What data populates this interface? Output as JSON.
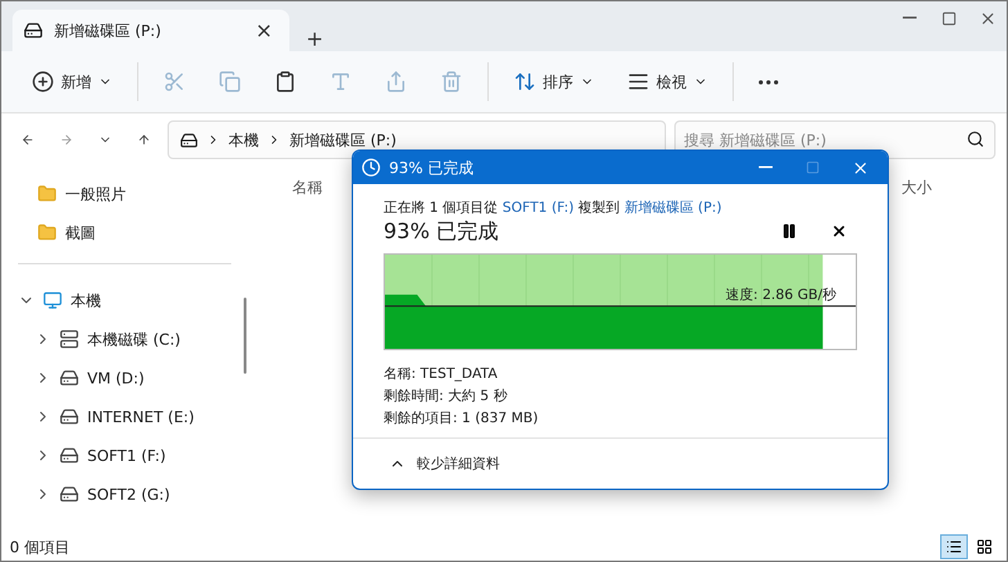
{
  "tab": {
    "title": "新增磁碟區 (P:)",
    "close": "×",
    "new_tab": "+"
  },
  "toolbar": [
    {
      "kind": "new",
      "label": "新增",
      "disabled": false,
      "menu": true
    },
    {
      "kind": "cut",
      "disabled": true
    },
    {
      "kind": "copy",
      "disabled": true
    },
    {
      "kind": "paste",
      "disabled": false
    },
    {
      "kind": "rename",
      "disabled": true
    },
    {
      "kind": "share",
      "disabled": true
    },
    {
      "kind": "delete",
      "disabled": true
    },
    {
      "kind": "sort",
      "label": "排序",
      "disabled": false,
      "menu": true
    },
    {
      "kind": "view",
      "label": "檢視",
      "disabled": false,
      "menu": true
    },
    {
      "kind": "more",
      "disabled": false
    }
  ],
  "address": {
    "path": [
      "本機",
      "新增磁碟區 (P:)"
    ]
  },
  "search": {
    "placeholder": "搜尋 新增磁碟區 (P:)"
  },
  "sidebar": {
    "quick": [
      {
        "label": "一般照片"
      },
      {
        "label": "截圖"
      }
    ],
    "tree": [
      {
        "label": "本機",
        "kind": "pc",
        "expanded": true,
        "children": [
          {
            "label": "本機磁碟 (C:)",
            "kind": "system",
            "expanded": false
          },
          {
            "label": "VM (D:)",
            "kind": "drive",
            "expanded": false
          },
          {
            "label": "INTERNET (E:)",
            "kind": "drive",
            "expanded": false
          },
          {
            "label": "SOFT1 (F:)",
            "kind": "drive",
            "expanded": false
          },
          {
            "label": "SOFT2 (G:)",
            "kind": "drive",
            "expanded": false
          }
        ]
      }
    ]
  },
  "columns": [
    "名稱",
    "大小"
  ],
  "status_bar": {
    "count": "0 個項目",
    "views": [
      {
        "kind": "details",
        "selected": true
      },
      {
        "kind": "tiles",
        "selected": false
      }
    ]
  },
  "dialog": {
    "title": "93% 已完成",
    "message": [
      {
        "kind": "text",
        "text": "正在將 1 個項目從 "
      },
      {
        "kind": "link",
        "text": "SOFT1 (F:)"
      },
      {
        "kind": "text",
        "text": " 複製到 "
      },
      {
        "kind": "link",
        "text": "新增磁碟區 (P:)"
      }
    ],
    "heading": "93% 已完成",
    "level": 0.93,
    "paused": false,
    "speed": "速度: 2.86 GB/秒",
    "details": [
      "名稱: TEST_DATA",
      "剩餘時間: 大約 5 秒",
      "剩餘的項目: 1 (837 MB)"
    ],
    "toggle": {
      "label": "較少詳細資料",
      "expanded": true
    }
  }
}
